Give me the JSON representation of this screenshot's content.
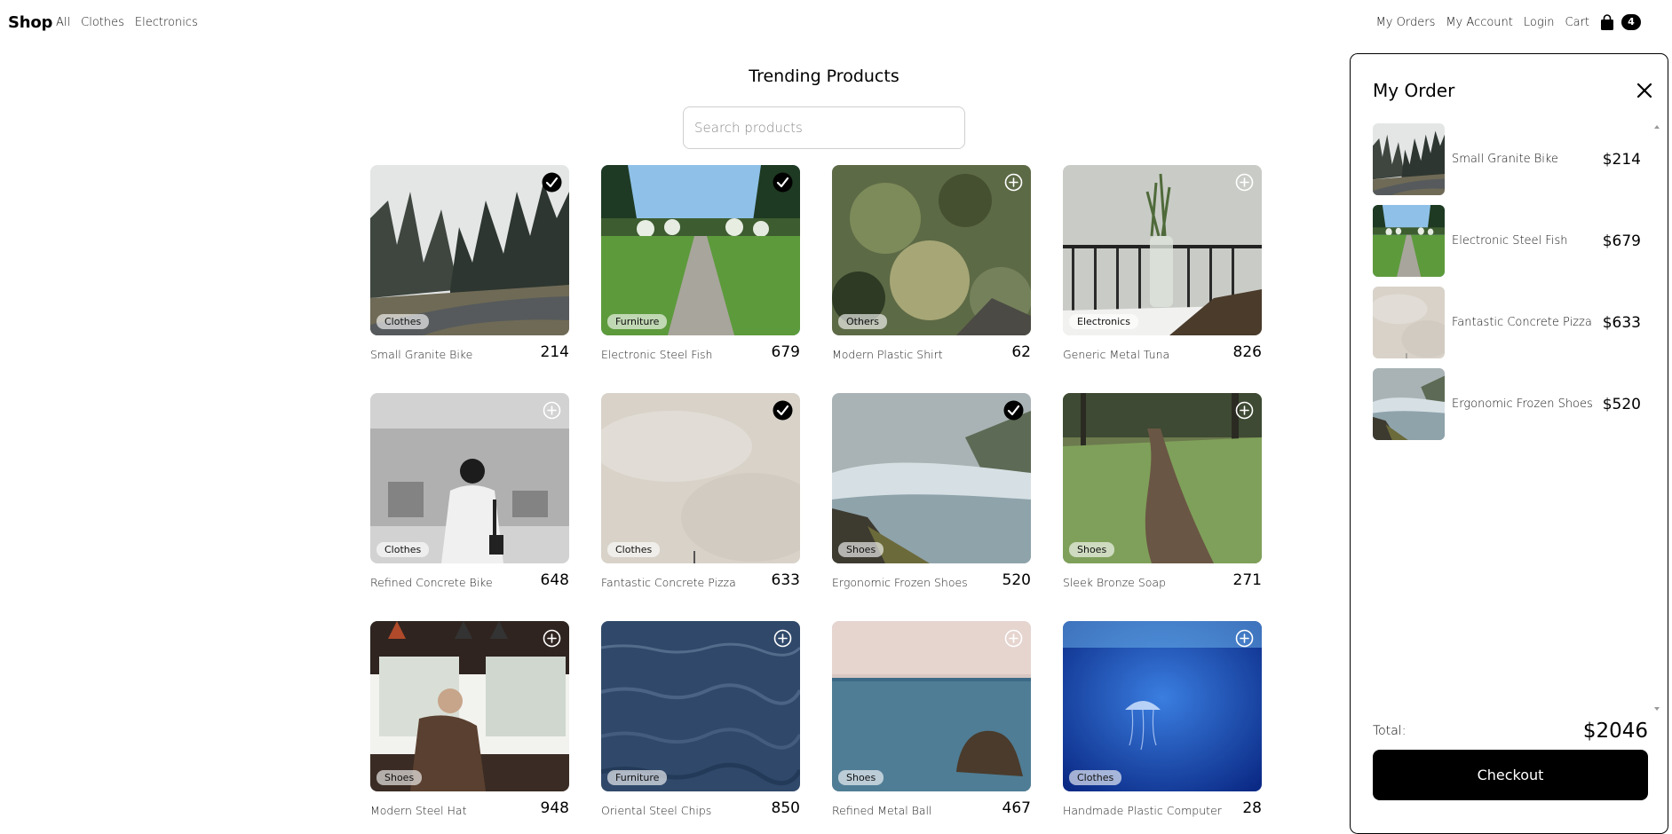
{
  "nav": {
    "brand": "Shop",
    "left": [
      "All",
      "Clothes",
      "Electronics"
    ],
    "right": [
      "My Orders",
      "My Account",
      "Login",
      "Cart"
    ],
    "cart_count": "4"
  },
  "main": {
    "title": "Trending Products",
    "search_placeholder": "Search products"
  },
  "products": [
    {
      "name": "Small Granite Bike",
      "price": "214",
      "category": "Clothes",
      "in_cart": true,
      "art": "road-forest"
    },
    {
      "name": "Electronic Steel Fish",
      "price": "679",
      "category": "Furniture",
      "in_cart": true,
      "art": "path-trees"
    },
    {
      "name": "Modern Plastic Shirt",
      "price": "62",
      "category": "Others",
      "in_cart": false,
      "art": "bokeh-trees"
    },
    {
      "name": "Generic Metal Tuna",
      "price": "826",
      "category": "Electronics",
      "in_cart": false,
      "art": "vase-balcony"
    },
    {
      "name": "Refined Concrete Bike",
      "price": "648",
      "category": "Clothes",
      "in_cart": false,
      "art": "metro-woman"
    },
    {
      "name": "Fantastic Concrete Pizza",
      "price": "633",
      "category": "Clothes",
      "in_cart": true,
      "art": "foggy-sky"
    },
    {
      "name": "Ergonomic Frozen Shoes",
      "price": "520",
      "category": "Shoes",
      "in_cart": true,
      "art": "waterfall"
    },
    {
      "name": "Sleek Bronze Soap",
      "price": "271",
      "category": "Shoes",
      "in_cart": false,
      "art": "forest-trail"
    },
    {
      "name": "Modern Steel Hat",
      "price": "948",
      "category": "Shoes",
      "in_cart": false,
      "art": "cafe-man"
    },
    {
      "name": "Oriental Steel Chips",
      "price": "850",
      "category": "Furniture",
      "in_cart": false,
      "art": "ocean-waves"
    },
    {
      "name": "Refined Metal Ball",
      "price": "467",
      "category": "Shoes",
      "in_cart": false,
      "art": "sea-rock"
    },
    {
      "name": "Handmade Plastic Computer",
      "price": "28",
      "category": "Clothes",
      "in_cart": false,
      "art": "jellyfish"
    }
  ],
  "order": {
    "title": "My Order",
    "items": [
      {
        "name": "Small Granite Bike",
        "price": "$214",
        "art": "road-forest"
      },
      {
        "name": "Electronic Steel Fish",
        "price": "$679",
        "art": "path-trees"
      },
      {
        "name": "Fantastic Concrete Pizza",
        "price": "$633",
        "art": "foggy-sky"
      },
      {
        "name": "Ergonomic Frozen Shoes",
        "price": "$520",
        "art": "waterfall"
      }
    ],
    "total_label": "Total:",
    "total_value": "$2046",
    "checkout_label": "Checkout"
  }
}
